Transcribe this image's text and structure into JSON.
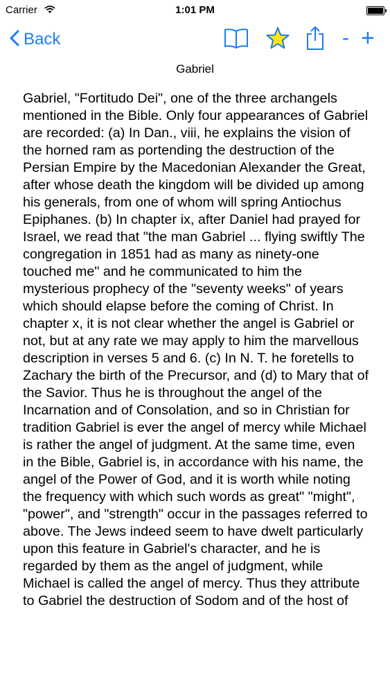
{
  "status_bar": {
    "carrier": "Carrier",
    "time": "1:01 PM"
  },
  "nav": {
    "back_label": "Back",
    "font_decrease": "-",
    "font_increase": "+"
  },
  "page": {
    "title": "Gabriel"
  },
  "colors": {
    "accent": "#1a7cf7",
    "star_fill": "#ffe800"
  },
  "icons": [
    "wifi-icon",
    "battery-icon",
    "back-chevron-icon",
    "book-icon",
    "star-icon",
    "share-icon"
  ],
  "article": {
    "text": "Gabriel, \"Fortitudo Dei\", one of the three archangels mentioned in the Bible. Only four appearances of Gabriel are recorded: (a) In Dan., viii, he explains the vision of the horned ram as portending the destruction of the Persian Empire by the Macedonian Alexander the Great, after whose death the kingdom will be divided up among his generals, from one of whom will spring Antiochus Epiphanes. (b) In chapter ix, after Daniel had prayed for Israel, we read that \"the man Gabriel ... flying swiftly The congregation in 1851 had as many as ninety-one touched me\" and he communicated to him the mysterious prophecy of the \"seventy weeks\" of years which should elapse before the coming of Christ. In chapter x, it is not clear whether the angel is Gabriel or not, but at any rate we may apply to him the marvellous description in verses 5 and 6. (c) In N. T. he foretells to Zachary the birth of the Precursor, and (d) to Mary that of the Savior. Thus he is throughout the angel of the Incarnation and of Consolation, and so in Christian for tradition Gabriel is ever the angel of mercy while Michael is rather the angel of judgment. At the same time, even in the Bible, Gabriel is, in accordance with his name, the angel of the Power of God, and it is worth while noting the frequency with which such words as great\" \"might\", \"power\", and \"strength\" occur in the passages referred to above. The Jews indeed seem to have dwelt particularly upon this feature in Gabriel's character, and he is regarded by them as the angel of judgment, while Michael is called the angel of mercy. Thus they attribute to Gabriel the destruction of Sodom and of the host of"
  }
}
